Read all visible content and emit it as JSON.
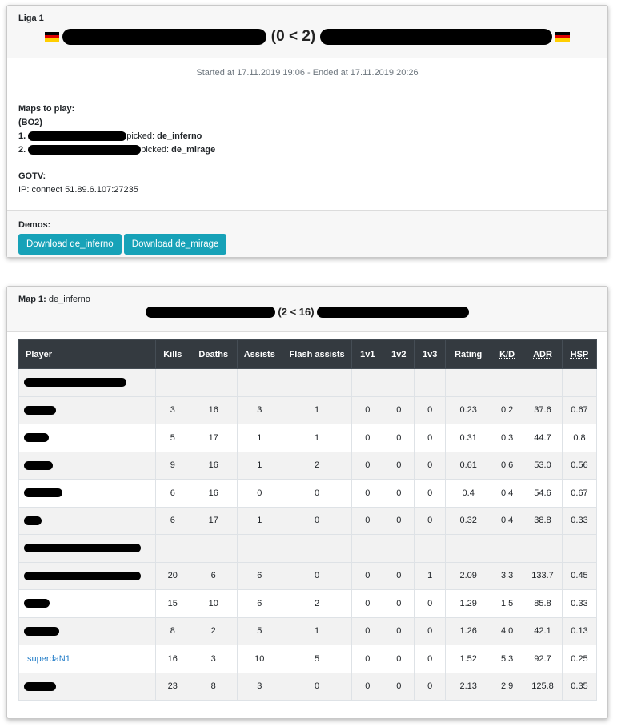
{
  "match": {
    "league": "Liga 1",
    "score_text": "(0 < 2)",
    "times": "Started at 17.11.2019 19:06 - Ended at 17.11.2019 20:26",
    "maps_title": "Maps to play:",
    "format": "(BO2)",
    "picks": [
      {
        "num": "1.",
        "picked_text": "picked:",
        "map": "de_inferno"
      },
      {
        "num": "2.",
        "picked_text": "picked:",
        "map": "de_mirage"
      }
    ],
    "gotv_title": "GOTV:",
    "gotv_ip": "IP: connect 51.89.6.107:27235",
    "demos_title": "Demos:",
    "demo_buttons": [
      "Download de_inferno",
      "Download de_mirage"
    ]
  },
  "map1": {
    "label": "Map 1:",
    "map_name": "de_inferno",
    "score_text": "(2 < 16)",
    "columns": [
      "Player",
      "Kills",
      "Deaths",
      "Assists",
      "Flash assists",
      "1v1",
      "1v2",
      "1v3",
      "Rating",
      "K/D",
      "ADR",
      "HSP"
    ],
    "rows": [
      {
        "type": "team",
        "name": ""
      },
      {
        "type": "player",
        "name": "",
        "stats": [
          "3",
          "16",
          "3",
          "1",
          "0",
          "0",
          "0",
          "0.23",
          "0.2",
          "37.6",
          "0.67"
        ]
      },
      {
        "type": "player",
        "name": "",
        "stats": [
          "5",
          "17",
          "1",
          "1",
          "0",
          "0",
          "0",
          "0.31",
          "0.3",
          "44.7",
          "0.8"
        ]
      },
      {
        "type": "player",
        "name": "",
        "stats": [
          "9",
          "16",
          "1",
          "2",
          "0",
          "0",
          "0",
          "0.61",
          "0.6",
          "53.0",
          "0.56"
        ]
      },
      {
        "type": "player",
        "name": "",
        "stats": [
          "6",
          "16",
          "0",
          "0",
          "0",
          "0",
          "0",
          "0.4",
          "0.4",
          "54.6",
          "0.67"
        ]
      },
      {
        "type": "player",
        "name": "",
        "stats": [
          "6",
          "17",
          "1",
          "0",
          "0",
          "0",
          "0",
          "0.32",
          "0.4",
          "38.8",
          "0.33"
        ]
      },
      {
        "type": "team",
        "name": ""
      },
      {
        "type": "player",
        "name": "",
        "stats": [
          "20",
          "6",
          "6",
          "0",
          "0",
          "0",
          "1",
          "2.09",
          "3.3",
          "133.7",
          "0.45"
        ]
      },
      {
        "type": "player",
        "name": "",
        "stats": [
          "15",
          "10",
          "6",
          "2",
          "0",
          "0",
          "0",
          "1.29",
          "1.5",
          "85.8",
          "0.33"
        ]
      },
      {
        "type": "player",
        "name": "",
        "stats": [
          "8",
          "2",
          "5",
          "1",
          "0",
          "0",
          "0",
          "1.26",
          "4.0",
          "42.1",
          "0.13"
        ]
      },
      {
        "type": "player",
        "name": "superdaN1",
        "stats": [
          "16",
          "3",
          "10",
          "5",
          "0",
          "0",
          "0",
          "1.52",
          "5.3",
          "92.7",
          "0.25"
        ]
      },
      {
        "type": "player",
        "name": "",
        "stats": [
          "23",
          "8",
          "3",
          "0",
          "0",
          "0",
          "0",
          "2.13",
          "2.9",
          "125.8",
          "0.35"
        ]
      }
    ]
  },
  "colors": {
    "header_dark": "#343a40",
    "button": "#17a2b8",
    "link": "#1f7bc7",
    "flag_black": "#000000",
    "flag_red": "#dd0000",
    "flag_gold": "#ffce00"
  },
  "icons": [
    "germany-flag-icon"
  ]
}
